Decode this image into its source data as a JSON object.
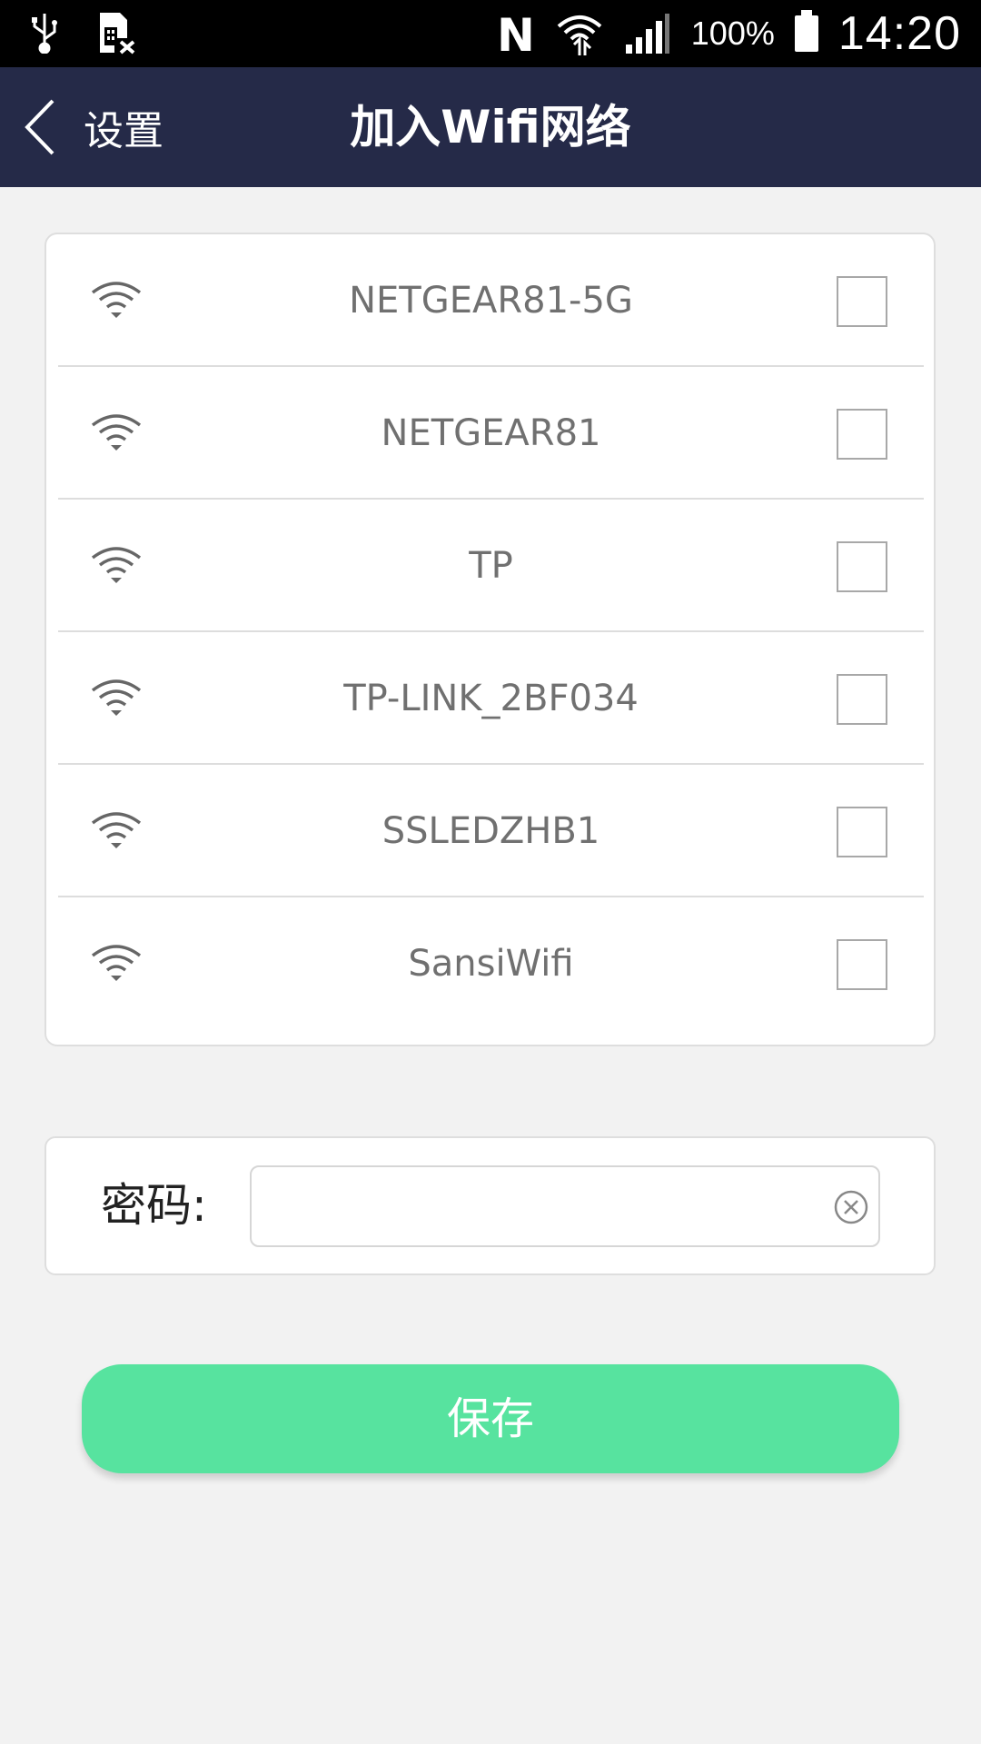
{
  "status_bar": {
    "icons": [
      "usb-icon",
      "sim-off-icon",
      "nfc-icon",
      "wifi-signal-icon",
      "cell-signal-icon",
      "battery-icon"
    ],
    "battery": "100%",
    "time": "14:20"
  },
  "nav": {
    "back_label": "设置",
    "title": "加入Wifi网络"
  },
  "wifi_list": [
    {
      "name": "NETGEAR81-5G",
      "checked": false
    },
    {
      "name": "NETGEAR81",
      "checked": false
    },
    {
      "name": "TP",
      "checked": false
    },
    {
      "name": "TP-LINK_2BF034",
      "checked": false
    },
    {
      "name": "SSLEDZHB1",
      "checked": false
    },
    {
      "name": "SansiWifi",
      "checked": false
    }
  ],
  "password": {
    "label": "密码:",
    "value": ""
  },
  "save_label": "保存",
  "colors": {
    "status_bar": "#000000",
    "nav_bar": "#252a48",
    "background": "#f2f2f2",
    "save_button": "#57e39f",
    "wifi_text": "#707070"
  }
}
